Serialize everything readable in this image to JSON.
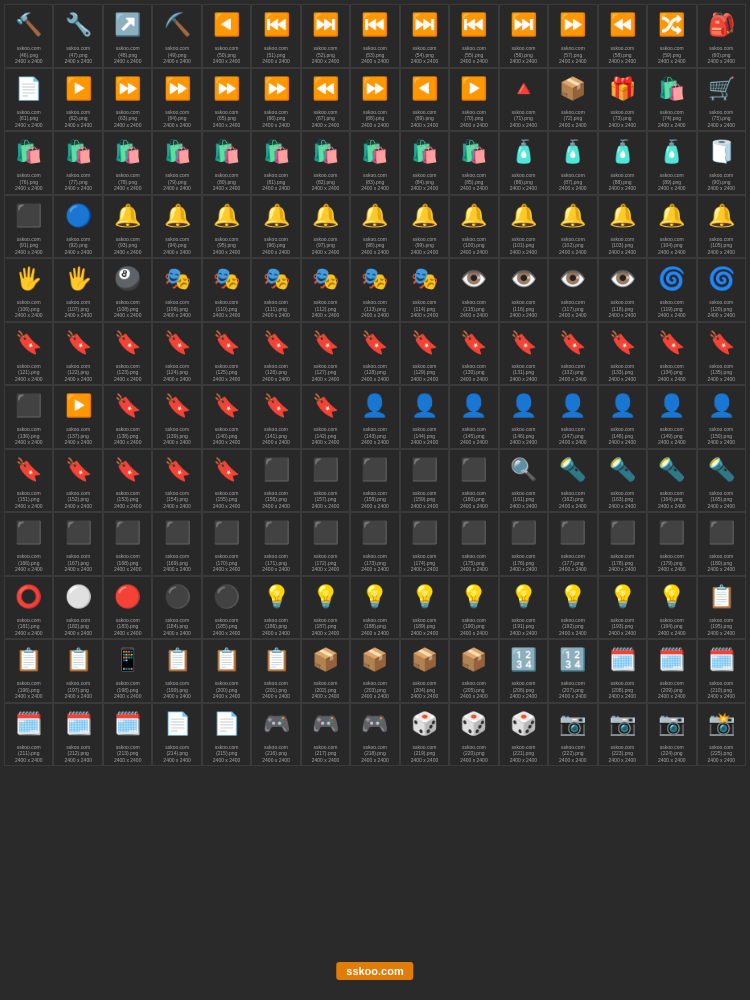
{
  "watermark": "sskoo.com",
  "grid": {
    "items": [
      {
        "id": 46,
        "emoji": "🔨",
        "color": "#ff6b35"
      },
      {
        "id": 47,
        "emoji": "🔧",
        "color": "#ffd700"
      },
      {
        "id": 48,
        "emoji": "↗️",
        "color": "#ffd700"
      },
      {
        "id": 49,
        "emoji": "⛏️",
        "color": "#888"
      },
      {
        "id": 50,
        "emoji": "◀️",
        "color": "#ff4444"
      },
      {
        "id": 51,
        "emoji": "⏮️",
        "color": "#ff4444"
      },
      {
        "id": 52,
        "emoji": "⏭️",
        "color": "#ff4444"
      },
      {
        "id": 53,
        "emoji": "⏮️",
        "color": "#ff4444"
      },
      {
        "id": 54,
        "emoji": "⏭️",
        "color": "#ff4444"
      },
      {
        "id": 55,
        "emoji": "⏮️",
        "color": "#888"
      },
      {
        "id": 56,
        "emoji": "⏭️",
        "color": "#888"
      },
      {
        "id": 57,
        "emoji": "⏩",
        "color": "#888"
      },
      {
        "id": 58,
        "emoji": "⏪",
        "color": "#888"
      },
      {
        "id": 59,
        "emoji": "🔀",
        "color": "#ff8844"
      },
      {
        "id": 60,
        "emoji": "🎒",
        "color": "#ffd700"
      },
      {
        "id": 61,
        "emoji": "📄",
        "color": "#aaa"
      },
      {
        "id": 62,
        "emoji": "▶️",
        "color": "#888"
      },
      {
        "id": 63,
        "emoji": "⏩",
        "color": "#ff4444"
      },
      {
        "id": 64,
        "emoji": "⏩",
        "color": "#ff4444"
      },
      {
        "id": 65,
        "emoji": "⏩",
        "color": "#ffd700"
      },
      {
        "id": 66,
        "emoji": "⏩",
        "color": "#ffd700"
      },
      {
        "id": 67,
        "emoji": "⏪",
        "color": "#ffd700"
      },
      {
        "id": 68,
        "emoji": "⏩",
        "color": "#ff8844"
      },
      {
        "id": 69,
        "emoji": "◀️",
        "color": "#ff6666"
      },
      {
        "id": 70,
        "emoji": "▶️",
        "color": "#ff8888"
      },
      {
        "id": 71,
        "emoji": "🔺",
        "color": "#ff8844"
      },
      {
        "id": 72,
        "emoji": "📦",
        "color": "#888"
      },
      {
        "id": 73,
        "emoji": "🎁",
        "color": "#888"
      },
      {
        "id": 74,
        "emoji": "🛍️",
        "color": "#ffd700"
      },
      {
        "id": 75,
        "emoji": "🛒",
        "color": "#ffd700"
      },
      {
        "id": 76,
        "emoji": "🛍️",
        "color": "#333"
      },
      {
        "id": 77,
        "emoji": "🛍️",
        "color": "#aa44ff"
      },
      {
        "id": 78,
        "emoji": "🛍️",
        "color": "#ffd700"
      },
      {
        "id": 79,
        "emoji": "🛍️",
        "color": "#44aaff"
      },
      {
        "id": 80,
        "emoji": "🛍️",
        "color": "#aaa"
      },
      {
        "id": 81,
        "emoji": "🛍️",
        "color": "#aaa"
      },
      {
        "id": 82,
        "emoji": "🛍️",
        "color": "#44ffaa"
      },
      {
        "id": 83,
        "emoji": "🛍️",
        "color": "#ffaa44"
      },
      {
        "id": 84,
        "emoji": "🛍️",
        "color": "#44aaff"
      },
      {
        "id": 85,
        "emoji": "🛍️",
        "color": "#ff4488"
      },
      {
        "id": 86,
        "emoji": "🧴",
        "color": "#aaa"
      },
      {
        "id": 87,
        "emoji": "🧴",
        "color": "#aaa"
      },
      {
        "id": 88,
        "emoji": "🧴",
        "color": "#aaa"
      },
      {
        "id": 89,
        "emoji": "🧴",
        "color": "#aaa"
      },
      {
        "id": 90,
        "emoji": "🧻",
        "color": "#aaa"
      },
      {
        "id": 91,
        "emoji": "⬛",
        "color": "#222"
      },
      {
        "id": 92,
        "emoji": "🔵",
        "color": "#4488ff"
      },
      {
        "id": 93,
        "emoji": "🔔",
        "color": "#ffd700"
      },
      {
        "id": 94,
        "emoji": "🔔",
        "color": "#ff6644"
      },
      {
        "id": 95,
        "emoji": "🔔",
        "color": "#ff4444"
      },
      {
        "id": 96,
        "emoji": "🔔",
        "color": "#ff4444"
      },
      {
        "id": 97,
        "emoji": "🔔",
        "color": "#ff4444"
      },
      {
        "id": 98,
        "emoji": "🔔",
        "color": "#aa44ff"
      },
      {
        "id": 99,
        "emoji": "🔔",
        "color": "#ffd700"
      },
      {
        "id": 100,
        "emoji": "🔔",
        "color": "#4488ff"
      },
      {
        "id": 101,
        "emoji": "🔔",
        "color": "#333"
      },
      {
        "id": 102,
        "emoji": "🔔",
        "color": "#333"
      },
      {
        "id": 103,
        "emoji": "🔔",
        "color": "#333"
      },
      {
        "id": 104,
        "emoji": "🔔",
        "color": "#333"
      },
      {
        "id": 105,
        "emoji": "🔔",
        "color": "#333"
      },
      {
        "id": 106,
        "emoji": "🖐️",
        "color": "#ffd700"
      },
      {
        "id": 107,
        "emoji": "🖐️",
        "color": "#ff6644"
      },
      {
        "id": 108,
        "emoji": "🎱",
        "color": "#222"
      },
      {
        "id": 109,
        "emoji": "🎭",
        "color": "#222"
      },
      {
        "id": 110,
        "emoji": "🎭",
        "color": "#ffd700"
      },
      {
        "id": 111,
        "emoji": "🎭",
        "color": "#ffd700"
      },
      {
        "id": 112,
        "emoji": "🎭",
        "color": "#ff6644"
      },
      {
        "id": 113,
        "emoji": "🎭",
        "color": "#ffd700"
      },
      {
        "id": 114,
        "emoji": "🎭",
        "color": "#ffd700"
      },
      {
        "id": 115,
        "emoji": "👁️",
        "color": "#ffd700"
      },
      {
        "id": 116,
        "emoji": "👁️",
        "color": "#ffd700"
      },
      {
        "id": 117,
        "emoji": "👁️",
        "color": "#ffd700"
      },
      {
        "id": 118,
        "emoji": "👁️",
        "color": "#ffd700"
      },
      {
        "id": 119,
        "emoji": "🌀",
        "color": "#88aaff"
      },
      {
        "id": 120,
        "emoji": "🌀",
        "color": "#88aaff"
      },
      {
        "id": 121,
        "emoji": "🔖",
        "color": "#333"
      },
      {
        "id": 122,
        "emoji": "🔖",
        "color": "#333"
      },
      {
        "id": 123,
        "emoji": "🔖",
        "color": "#333"
      },
      {
        "id": 124,
        "emoji": "🔖",
        "color": "#aa44ff"
      },
      {
        "id": 125,
        "emoji": "🔖",
        "color": "#4488ff"
      },
      {
        "id": 126,
        "emoji": "🔖",
        "color": "#ffd700"
      },
      {
        "id": 127,
        "emoji": "🔖",
        "color": "#ffd700"
      },
      {
        "id": 128,
        "emoji": "🔖",
        "color": "#aaa"
      },
      {
        "id": 129,
        "emoji": "🔖",
        "color": "#aaa"
      },
      {
        "id": 130,
        "emoji": "🔖",
        "color": "#ffd700"
      },
      {
        "id": 131,
        "emoji": "🔖",
        "color": "#ffd700"
      },
      {
        "id": 132,
        "emoji": "🔖",
        "color": "#ffd700"
      },
      {
        "id": 133,
        "emoji": "🔖",
        "color": "#aaa"
      },
      {
        "id": 134,
        "emoji": "🔖",
        "color": "#ffd700"
      },
      {
        "id": 135,
        "emoji": "🔖",
        "color": "#aaa"
      },
      {
        "id": 136,
        "emoji": "⬛",
        "color": "#333"
      },
      {
        "id": 137,
        "emoji": "▶️",
        "color": "#ffd700"
      },
      {
        "id": 138,
        "emoji": "🔖",
        "color": "#333"
      },
      {
        "id": 139,
        "emoji": "🔖",
        "color": "#aa44ff"
      },
      {
        "id": 140,
        "emoji": "🔖",
        "color": "#aa44ff"
      },
      {
        "id": 141,
        "emoji": "🔖",
        "color": "#ffd700"
      },
      {
        "id": 142,
        "emoji": "🔖",
        "color": "#ffd700"
      },
      {
        "id": 143,
        "emoji": "👤",
        "color": "#888"
      },
      {
        "id": 144,
        "emoji": "👤",
        "color": "#888"
      },
      {
        "id": 145,
        "emoji": "👤",
        "color": "#888"
      },
      {
        "id": 146,
        "emoji": "👤",
        "color": "#888"
      },
      {
        "id": 147,
        "emoji": "👤",
        "color": "#888"
      },
      {
        "id": 148,
        "emoji": "👤",
        "color": "#888"
      },
      {
        "id": 149,
        "emoji": "👤",
        "color": "#888"
      },
      {
        "id": 150,
        "emoji": "👤",
        "color": "#888"
      },
      {
        "id": 151,
        "emoji": "🔖",
        "color": "#333"
      },
      {
        "id": 152,
        "emoji": "🔖",
        "color": "#333"
      },
      {
        "id": 153,
        "emoji": "🔖",
        "color": "#333"
      },
      {
        "id": 154,
        "emoji": "🔖",
        "color": "#aa44ff"
      },
      {
        "id": 155,
        "emoji": "🔖",
        "color": "#aa44ff"
      },
      {
        "id": 156,
        "emoji": "⬛",
        "color": "#333"
      },
      {
        "id": 157,
        "emoji": "⬛",
        "color": "#333"
      },
      {
        "id": 158,
        "emoji": "⬛",
        "color": "#333"
      },
      {
        "id": 159,
        "emoji": "⬛",
        "color": "#333"
      },
      {
        "id": 160,
        "emoji": "⬛",
        "color": "#333"
      },
      {
        "id": 161,
        "emoji": "🔍",
        "color": "#ffd700"
      },
      {
        "id": 162,
        "emoji": "🔦",
        "color": "#ffd700"
      },
      {
        "id": 163,
        "emoji": "🔦",
        "color": "#ffd700"
      },
      {
        "id": 164,
        "emoji": "🔦",
        "color": "#ff8844"
      },
      {
        "id": 165,
        "emoji": "🔦",
        "color": "#ff8844"
      },
      {
        "id": 166,
        "emoji": "⬛",
        "color": "#333"
      },
      {
        "id": 167,
        "emoji": "⬛",
        "color": "#333"
      },
      {
        "id": 168,
        "emoji": "⬛",
        "color": "#333"
      },
      {
        "id": 169,
        "emoji": "⬛",
        "color": "#333"
      },
      {
        "id": 170,
        "emoji": "⬛",
        "color": "#333"
      },
      {
        "id": 171,
        "emoji": "⬛",
        "color": "#333"
      },
      {
        "id": 172,
        "emoji": "⬛",
        "color": "#333"
      },
      {
        "id": 173,
        "emoji": "⬛",
        "color": "#333"
      },
      {
        "id": 174,
        "emoji": "⬛",
        "color": "#333"
      },
      {
        "id": 175,
        "emoji": "⬛",
        "color": "#333"
      },
      {
        "id": 176,
        "emoji": "⬛",
        "color": "#333"
      },
      {
        "id": 177,
        "emoji": "⬛",
        "color": "#333"
      },
      {
        "id": 178,
        "emoji": "⬛",
        "color": "#333"
      },
      {
        "id": 179,
        "emoji": "⬛",
        "color": "#333"
      },
      {
        "id": 180,
        "emoji": "⬛",
        "color": "#333"
      },
      {
        "id": 181,
        "emoji": "⭕",
        "color": "#ff6644"
      },
      {
        "id": 182,
        "emoji": "⚪",
        "color": "#ddd"
      },
      {
        "id": 183,
        "emoji": "🔴",
        "color": "#ff4488"
      },
      {
        "id": 184,
        "emoji": "⚫",
        "color": "#333"
      },
      {
        "id": 185,
        "emoji": "⚫",
        "color": "#333"
      },
      {
        "id": 186,
        "emoji": "💡",
        "color": "#ffd700"
      },
      {
        "id": 187,
        "emoji": "💡",
        "color": "#ffd700"
      },
      {
        "id": 188,
        "emoji": "💡",
        "color": "#ffd700"
      },
      {
        "id": 189,
        "emoji": "💡",
        "color": "#ffd700"
      },
      {
        "id": 190,
        "emoji": "💡",
        "color": "#ffd700"
      },
      {
        "id": 191,
        "emoji": "💡",
        "color": "#aaa"
      },
      {
        "id": 192,
        "emoji": "💡",
        "color": "#aaa"
      },
      {
        "id": 193,
        "emoji": "💡",
        "color": "#aaa"
      },
      {
        "id": 194,
        "emoji": "💡",
        "color": "#aaa"
      },
      {
        "id": 195,
        "emoji": "📋",
        "color": "#aaa"
      },
      {
        "id": 196,
        "emoji": "📋",
        "color": "#aaa"
      },
      {
        "id": 197,
        "emoji": "📋",
        "color": "#aaa"
      },
      {
        "id": 198,
        "emoji": "📱",
        "color": "#4488ff"
      },
      {
        "id": 199,
        "emoji": "📋",
        "color": "#aaa"
      },
      {
        "id": 200,
        "emoji": "📋",
        "color": "#aaa"
      },
      {
        "id": 201,
        "emoji": "📋",
        "color": "#aaa"
      },
      {
        "id": 202,
        "emoji": "📦",
        "color": "#ffd700"
      },
      {
        "id": 203,
        "emoji": "📦",
        "color": "#ffd700"
      },
      {
        "id": 204,
        "emoji": "📦",
        "color": "#ffd700"
      },
      {
        "id": 205,
        "emoji": "📦",
        "color": "#ffd700"
      },
      {
        "id": 206,
        "emoji": "🔢",
        "color": "#ffd700"
      },
      {
        "id": 207,
        "emoji": "🔢",
        "color": "#ffd700"
      },
      {
        "id": 208,
        "emoji": "🗓️",
        "color": "#ff4444"
      },
      {
        "id": 209,
        "emoji": "🗓️",
        "color": "#ff4444"
      },
      {
        "id": 210,
        "emoji": "🗓️",
        "color": "#ff4444"
      },
      {
        "id": 211,
        "emoji": "🗓️",
        "color": "#ff4444"
      },
      {
        "id": 212,
        "emoji": "🗓️",
        "color": "#ff4444"
      },
      {
        "id": 213,
        "emoji": "🗓️",
        "color": "#ff4444"
      },
      {
        "id": 214,
        "emoji": "📄",
        "color": "#aaa"
      },
      {
        "id": 215,
        "emoji": "📄",
        "color": "#aaa"
      },
      {
        "id": 216,
        "emoji": "🎮",
        "color": "#ff4488"
      },
      {
        "id": 217,
        "emoji": "🎮",
        "color": "#aa44ff"
      },
      {
        "id": 218,
        "emoji": "🎮",
        "color": "#ffd700"
      },
      {
        "id": 219,
        "emoji": "🎲",
        "color": "#ffd700"
      },
      {
        "id": 220,
        "emoji": "🎲",
        "color": "#ffd700"
      },
      {
        "id": 221,
        "emoji": "🎲",
        "color": "#ffd700"
      },
      {
        "id": 222,
        "emoji": "📷",
        "color": "#333"
      },
      {
        "id": 223,
        "emoji": "📷",
        "color": "#333"
      },
      {
        "id": 224,
        "emoji": "📷",
        "color": "#333"
      },
      {
        "id": 225,
        "emoji": "📸",
        "color": "#333"
      }
    ],
    "label_suffix": "png",
    "size_text": "2400 x 2400",
    "domain": "sskoo.com"
  }
}
